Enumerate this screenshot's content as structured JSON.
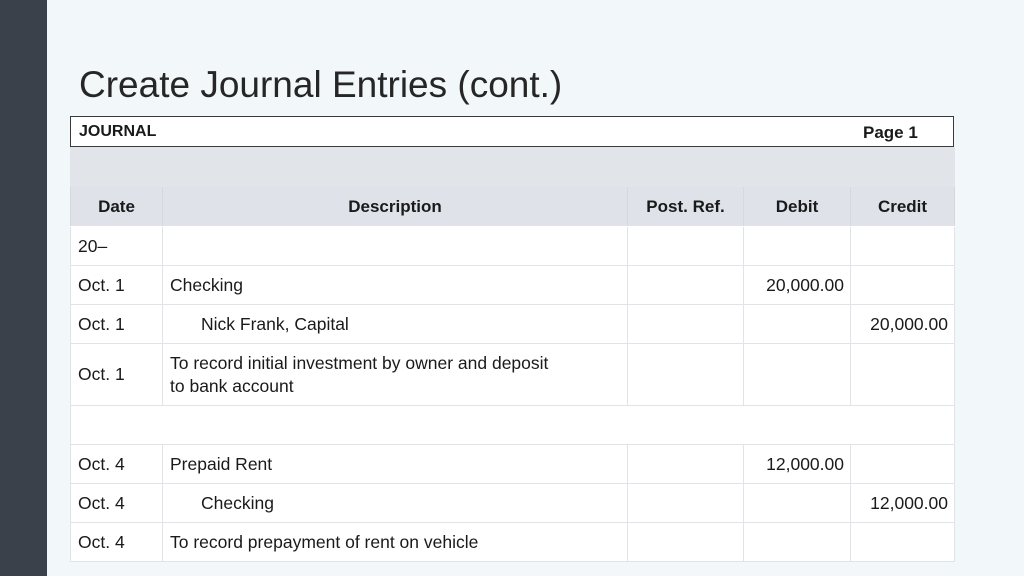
{
  "slide": {
    "title": "Create Journal Entries (cont.)"
  },
  "journal": {
    "label": "JOURNAL",
    "page": "Page 1",
    "columns": {
      "date": "Date",
      "description": "Description",
      "post_ref": "Post. Ref.",
      "debit": "Debit",
      "credit": "Credit"
    },
    "rows": [
      {
        "date": "20–",
        "description": "",
        "post_ref": "",
        "debit": "",
        "credit": ""
      },
      {
        "date": "Oct. 1",
        "description": "Checking",
        "post_ref": "",
        "debit": "20,000.00",
        "credit": ""
      },
      {
        "date": "Oct. 1",
        "description": "Nick Frank, Capital",
        "post_ref": "",
        "debit": "",
        "credit": "20,000.00"
      },
      {
        "date": "Oct. 1",
        "description": "To record initial investment by owner and deposit to bank account",
        "post_ref": "",
        "debit": "",
        "credit": ""
      },
      {
        "date": "",
        "description": "",
        "post_ref": "",
        "debit": "",
        "credit": ""
      },
      {
        "date": "Oct. 4",
        "description": "Prepaid Rent",
        "post_ref": "",
        "debit": "12,000.00",
        "credit": ""
      },
      {
        "date": "Oct. 4",
        "description": "Checking",
        "post_ref": "",
        "debit": "",
        "credit": "12,000.00"
      },
      {
        "date": "Oct. 4",
        "description": "To record prepayment of rent on vehicle",
        "post_ref": "",
        "debit": "",
        "credit": ""
      }
    ]
  }
}
